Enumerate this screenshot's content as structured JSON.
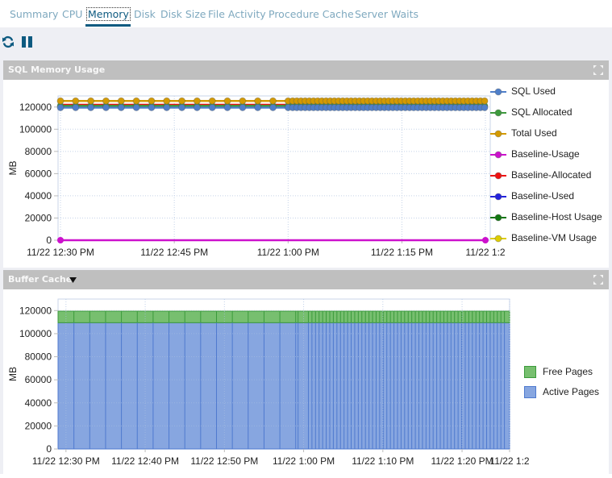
{
  "tabs": [
    {
      "label": "Summary",
      "active": false
    },
    {
      "label": "CPU",
      "active": false
    },
    {
      "label": "Memory",
      "active": true
    },
    {
      "label": "Disk",
      "active": false
    },
    {
      "label": "Disk Size",
      "active": false
    },
    {
      "label": "File Activity",
      "active": false
    },
    {
      "label": "Procedure Cache",
      "active": false
    },
    {
      "label": "Server Waits",
      "active": false
    }
  ],
  "toolbar": {
    "refresh_icon": "refresh-icon",
    "pause_icon": "pause-icon"
  },
  "colors": {
    "accent": "#0d5a80",
    "tab_inactive": "#7fa9bf",
    "panel_header": "#bfbfbf",
    "toolbar_bg": "#eeeff4"
  },
  "panels": {
    "sql_memory": {
      "title": "SQL Memory Usage"
    },
    "buffer_cache": {
      "title": "Buffer Cache",
      "dropdown_icon": "caret-down-icon"
    }
  },
  "chart_data": [
    {
      "type": "line",
      "title": "SQL Memory Usage",
      "xlabel": "",
      "ylabel": "MB",
      "ylim": [
        0,
        130000
      ],
      "yticks": [
        0,
        20000,
        40000,
        60000,
        80000,
        100000,
        120000
      ],
      "ytick_labels": [
        "0",
        "20000",
        "40000",
        "60000",
        "80000",
        "100000",
        "120000"
      ],
      "xlim_minutes": [
        0,
        56
      ],
      "xtick_minutes": [
        0,
        15,
        30,
        45,
        56
      ],
      "xtick_labels": [
        "11/22 12:30 PM",
        "11/22 12:45 PM",
        "11/22 1:00 PM",
        "11/22 1:15 PM",
        "11/22 1:2"
      ],
      "grid": true,
      "legend_position": "right",
      "sample_minutes": "every 2 min from 0 to 30, every 0.5 min from 30 to 56",
      "series": [
        {
          "name": "SQL Used",
          "color": "#4f7fc9",
          "value": 119500,
          "markers": true
        },
        {
          "name": "SQL Allocated",
          "color": "#3d9a3d",
          "value": 121000,
          "markers": true
        },
        {
          "name": "Total Used",
          "color": "#d49a00",
          "value": 125500,
          "markers": true
        },
        {
          "name": "Baseline-Usage",
          "color": "#cc11cc",
          "value": 0,
          "markers": "endpoints"
        },
        {
          "name": "Baseline-Allocated",
          "color": "#ee1111",
          "value": 122000,
          "markers": false
        },
        {
          "name": "Baseline-Used",
          "color": "#2222dd",
          "value": null,
          "markers": false
        },
        {
          "name": "Baseline-Host Usage",
          "color": "#117711",
          "value": null,
          "markers": false
        },
        {
          "name": "Baseline-VM Usage",
          "color": "#ddcc00",
          "value": null,
          "markers": false
        }
      ]
    },
    {
      "type": "area",
      "title": "Buffer Cache",
      "xlabel": "",
      "ylabel": "MB",
      "ylim": [
        0,
        130000
      ],
      "yticks": [
        0,
        20000,
        40000,
        60000,
        80000,
        100000,
        120000
      ],
      "ytick_labels": [
        "0",
        "20000",
        "40000",
        "60000",
        "80000",
        "100000",
        "120000"
      ],
      "xlim_minutes": [
        -1,
        56
      ],
      "xtick_minutes": [
        0,
        10,
        20,
        30,
        40,
        50,
        56
      ],
      "xtick_labels": [
        "11/22 12:30 PM",
        "11/22 12:40 PM",
        "11/22 12:50 PM",
        "11/22 1:00 PM",
        "11/22 1:10 PM",
        "11/22 1:20 PM",
        "11/22 1:2"
      ],
      "grid": true,
      "stacked": true,
      "legend_position": "right",
      "series": [
        {
          "name": "Free Pages",
          "color": "#77bf6f",
          "stroke": "#3b9a3b",
          "value": 10000
        },
        {
          "name": "Active Pages",
          "color": "#87a6e0",
          "stroke": "#4f7acf",
          "value": 109500
        }
      ]
    }
  ]
}
